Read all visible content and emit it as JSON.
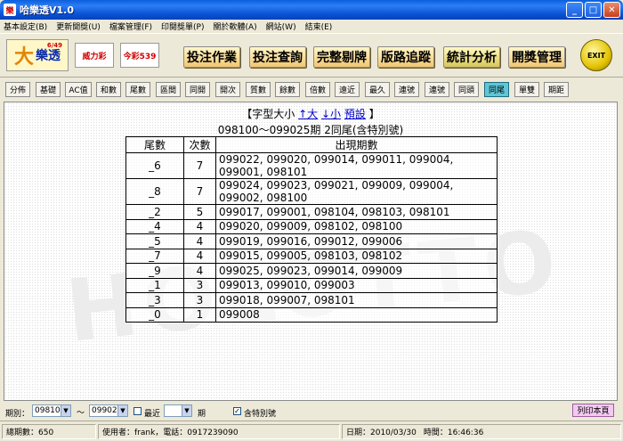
{
  "window": {
    "title": "哈樂透V1.0",
    "minimize": "_",
    "maximize": "□",
    "close": "✕"
  },
  "menu": [
    "基本設定(B)",
    "更新開獎(U)",
    "檔案管理(F)",
    "印閱獎單(P)",
    "關於軟體(A)",
    "網站(W)",
    "結束(E)"
  ],
  "logos": {
    "lotto": "樂透",
    "lotto_big": "大",
    "lotto_small": "6/49",
    "power": "威力彩",
    "five39": "今彩539"
  },
  "toolbar": [
    "投注作業",
    "投注查詢",
    "完整剔牌",
    "版路追蹤",
    "統計分析",
    "開獎管理"
  ],
  "exit_label": "EXIT",
  "analysis_buttons": [
    "分佈",
    "基礎",
    "AC值",
    "和數",
    "尾數",
    "區間",
    "同開",
    "開次",
    "質數",
    "餘數",
    "倍數",
    "遠近",
    "最久",
    "連號",
    "連號",
    "同頭",
    "同尾",
    "單雙",
    "期距"
  ],
  "font_line": {
    "prefix": "【字型大小",
    "up": "↑大",
    "down": "↓小",
    "default": "預設",
    "suffix": "】"
  },
  "subtitle": "098100～099025期 2同尾(含特別號)",
  "table": {
    "headers": [
      "尾數",
      "次數",
      "出現期數"
    ],
    "rows": [
      [
        "_6",
        "7",
        "099022, 099020, 099014, 099011, 099004, 099001, 098101"
      ],
      [
        "_8",
        "7",
        "099024, 099023, 099021, 099009, 099004, 099002, 098100"
      ],
      [
        "_2",
        "5",
        "099017, 099001, 098104, 098103, 098101"
      ],
      [
        "_4",
        "4",
        "099020, 099009, 098102, 098100"
      ],
      [
        "_5",
        "4",
        "099019, 099016, 099012, 099006"
      ],
      [
        "_7",
        "4",
        "099015, 099005, 098103, 098102"
      ],
      [
        "_9",
        "4",
        "099025, 099023, 099014, 099009"
      ],
      [
        "_1",
        "3",
        "099013, 099010, 099003"
      ],
      [
        "_3",
        "3",
        "099018, 099007, 098101"
      ],
      [
        "_0",
        "1",
        "099008"
      ]
    ]
  },
  "watermark": "HOLOTTO",
  "controls": {
    "period_label": "期別：",
    "from": "098100",
    "to": "099025",
    "tilde": "～",
    "recent_label": "最近",
    "period_unit": "期",
    "include_special": "含特別號",
    "print": "列印本頁"
  },
  "status": {
    "total": "總期數：650",
    "user": "使用者：frank，電話：0917239090",
    "date": "日期：2010/03/30",
    "time": "時間：16:46:36"
  }
}
